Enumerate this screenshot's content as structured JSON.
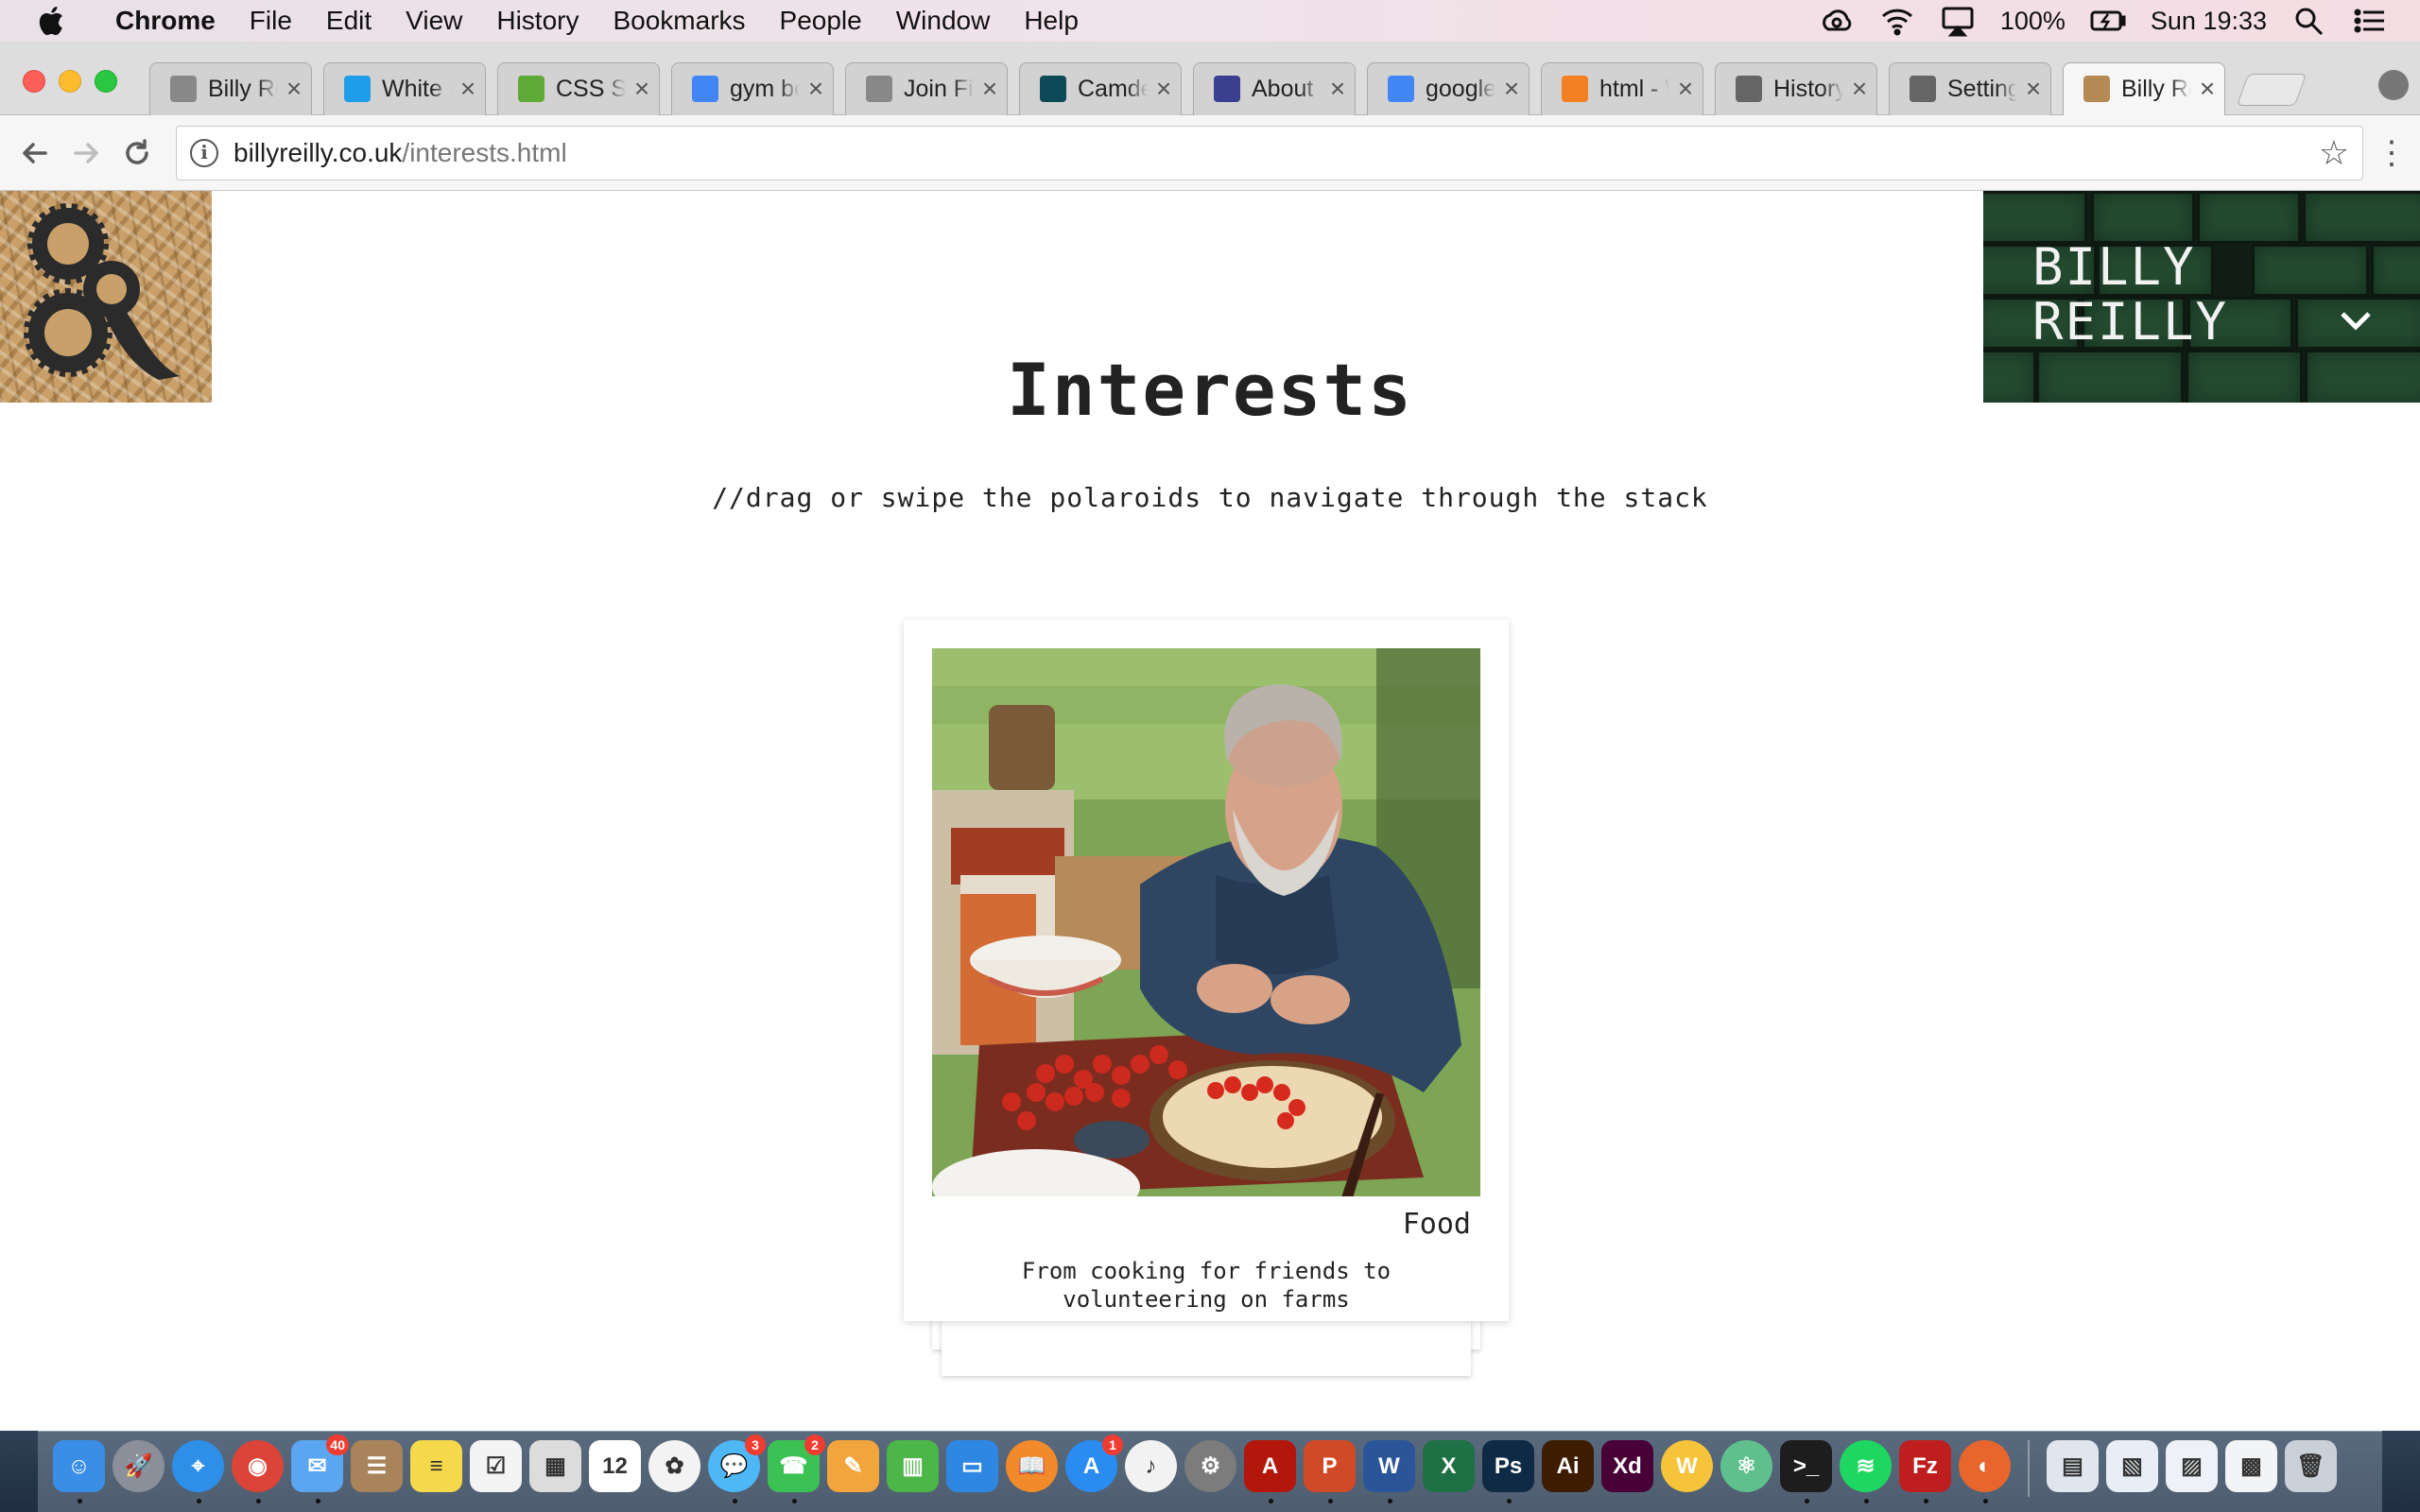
{
  "menubar": {
    "app_name": "Chrome",
    "items": [
      "File",
      "Edit",
      "View",
      "History",
      "Bookmarks",
      "People",
      "Window",
      "Help"
    ],
    "battery": "100%",
    "clock": "Sun 19:33"
  },
  "tabs": [
    {
      "label": "Billy Re",
      "icon": "page-icon",
      "color": "#888888"
    },
    {
      "label": "White s",
      "icon": "sketch-icon",
      "color": "#1e9ee8"
    },
    {
      "label": "CSS St",
      "icon": "w3-icon",
      "color": "#5faa36"
    },
    {
      "label": "gym bo",
      "icon": "google-icon",
      "color": "#4285f4"
    },
    {
      "label": "Join Fit",
      "icon": "page-icon",
      "color": "#888888"
    },
    {
      "label": "Camde",
      "icon": "camden-icon",
      "color": "#0d4a58"
    },
    {
      "label": "About I",
      "icon": "site-icon",
      "color": "#3a3f8f"
    },
    {
      "label": "googlef",
      "icon": "google-icon",
      "color": "#4285f4"
    },
    {
      "label": "html - \\",
      "icon": "stackoverflow-icon",
      "color": "#f48024"
    },
    {
      "label": "History",
      "icon": "history-icon",
      "color": "#666666"
    },
    {
      "label": "Setting",
      "icon": "gear-icon",
      "color": "#666666"
    },
    {
      "label": "Billy Re",
      "icon": "logo-icon",
      "color": "#b58a55",
      "active": true
    }
  ],
  "omnibox": {
    "domain": "billyreilly.co.uk",
    "path": "/interests.html"
  },
  "page": {
    "name_line1": "BILLY",
    "name_line2": "REILLY",
    "title": "Interests",
    "subtitle": "//drag or swipe the polaroids to navigate through the stack",
    "card": {
      "title": "Food",
      "description": "From cooking for friends to volunteering on farms"
    }
  },
  "dock": {
    "apps": [
      {
        "name": "finder-icon",
        "color": "#3a8ee6",
        "glyph": "☺",
        "running": true
      },
      {
        "name": "launchpad-icon",
        "color": "#8a8f99",
        "glyph": "🚀",
        "round": true
      },
      {
        "name": "safari-icon",
        "color": "#2d8fe8",
        "glyph": "⌖",
        "round": true,
        "running": true
      },
      {
        "name": "chrome-icon",
        "color": "#db4437",
        "glyph": "◉",
        "round": true,
        "running": true
      },
      {
        "name": "mail-icon",
        "color": "#5aa6f0",
        "glyph": "✉",
        "badge": "40",
        "running": true
      },
      {
        "name": "contacts-icon",
        "color": "#a9845a",
        "glyph": "☰"
      },
      {
        "name": "notes-icon",
        "color": "#f5d94b",
        "glyph": "≡"
      },
      {
        "name": "reminders-icon",
        "color": "#f4f4f4",
        "glyph": "☑"
      },
      {
        "name": "preview-icon",
        "color": "#dcdcdc",
        "glyph": "▦"
      },
      {
        "name": "calendar-icon",
        "color": "#ffffff",
        "glyph": "12"
      },
      {
        "name": "photos-icon",
        "color": "#f3f3f3",
        "glyph": "✿",
        "round": true
      },
      {
        "name": "messages-icon",
        "color": "#4db8f5",
        "glyph": "💬",
        "badge": "3",
        "round": true,
        "running": true
      },
      {
        "name": "facetime-icon",
        "color": "#3cc254",
        "glyph": "☎",
        "badge": "2",
        "running": true
      },
      {
        "name": "pages-icon",
        "color": "#f2a53c",
        "glyph": "✎"
      },
      {
        "name": "numbers-icon",
        "color": "#4cb648",
        "glyph": "▥"
      },
      {
        "name": "keynote-icon",
        "color": "#2e87e3",
        "glyph": "▭"
      },
      {
        "name": "ibooks-icon",
        "color": "#f08a2a",
        "glyph": "📖",
        "round": true
      },
      {
        "name": "appstore-icon",
        "color": "#2a8cf0",
        "glyph": "A",
        "badge": "1",
        "round": true
      },
      {
        "name": "itunes-icon",
        "color": "#f2f2f2",
        "glyph": "♪",
        "round": true
      },
      {
        "name": "system-preferences-icon",
        "color": "#7c7c7c",
        "glyph": "⚙",
        "round": true
      },
      {
        "name": "acrobat-icon",
        "color": "#b3160b",
        "glyph": "A",
        "running": true
      },
      {
        "name": "powerpoint-icon",
        "color": "#d04a27",
        "glyph": "P",
        "running": true
      },
      {
        "name": "word-icon",
        "color": "#2a5699",
        "glyph": "W",
        "running": true
      },
      {
        "name": "excel-icon",
        "color": "#1e7145",
        "glyph": "X"
      },
      {
        "name": "photoshop-icon",
        "color": "#0e2a44",
        "glyph": "Ps",
        "running": true
      },
      {
        "name": "illustrator-icon",
        "color": "#3d1c00",
        "glyph": "Ai"
      },
      {
        "name": "xd-icon",
        "color": "#470137",
        "glyph": "Xd"
      },
      {
        "name": "sublime-icon",
        "color": "#f5c43b",
        "glyph": "W",
        "round": true
      },
      {
        "name": "atom-icon",
        "color": "#5fbf8d",
        "glyph": "⚛",
        "round": true
      },
      {
        "name": "terminal-icon",
        "color": "#1d1d1d",
        "glyph": ">_",
        "running": true
      },
      {
        "name": "spotify-icon",
        "color": "#1ed760",
        "glyph": "≋",
        "round": true,
        "running": true
      },
      {
        "name": "filezilla-icon",
        "color": "#bf1e1e",
        "glyph": "Fz",
        "running": true
      },
      {
        "name": "firefox-icon",
        "color": "#e8662d",
        "glyph": "◐",
        "round": true,
        "running": true
      },
      {
        "sep": true
      },
      {
        "name": "documents-folder-icon",
        "color": "#dfe6ee",
        "glyph": "▤"
      },
      {
        "name": "downloads-stack-icon",
        "color": "#e8eef5",
        "glyph": "▧"
      },
      {
        "name": "screenshots-stack-icon",
        "color": "#eef2f6",
        "glyph": "▨"
      },
      {
        "name": "desktop-stack-icon",
        "color": "#f2f4f6",
        "glyph": "▩"
      },
      {
        "name": "trash-icon",
        "color": "#c9d0d8",
        "glyph": "🗑"
      }
    ]
  }
}
